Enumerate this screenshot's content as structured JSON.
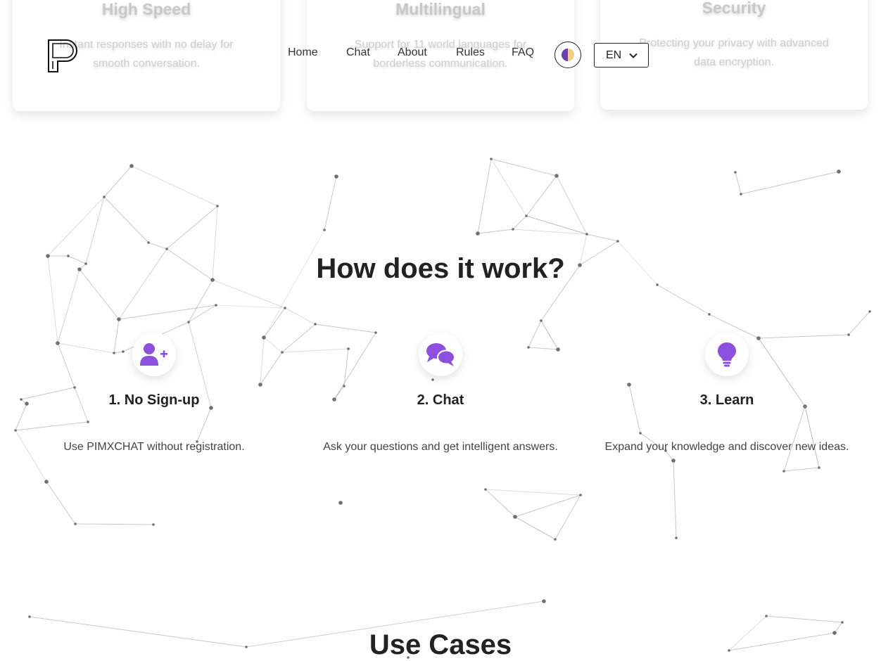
{
  "colors": {
    "accent": "#8c4fe0",
    "text": "#222222",
    "network": "#9a9a9a"
  },
  "features": [
    {
      "title": "High Speed",
      "desc": "Instant responses with no delay for smooth conversation."
    },
    {
      "title": "Multilingual",
      "desc": "Support for 11 world languages for borderless communication."
    },
    {
      "title": "Security",
      "desc": "Protecting your privacy with advanced data encryption."
    }
  ],
  "nav": {
    "links": [
      "Home",
      "Chat",
      "About",
      "Rules",
      "FAQ"
    ],
    "language": "EN",
    "theme_icon": "half-moon-icon"
  },
  "how": {
    "title": "How does it work?",
    "steps": [
      {
        "icon": "user-plus-icon",
        "title": "1. No Sign-up",
        "desc": "Use PIMXCHAT without registration."
      },
      {
        "icon": "chat-bubbles-icon",
        "title": "2. Chat",
        "desc": "Ask your questions and get intelligent answers."
      },
      {
        "icon": "lightbulb-icon",
        "title": "3. Learn",
        "desc": "Expand your knowledge and discover new ideas."
      }
    ]
  },
  "use_cases": {
    "title": "Use Cases"
  }
}
